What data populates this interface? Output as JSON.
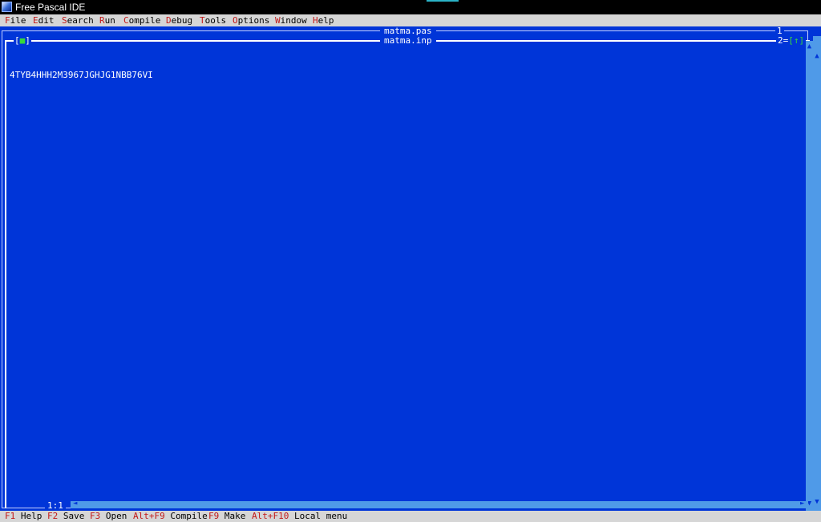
{
  "window": {
    "title": "Free Pascal IDE"
  },
  "menu": [
    {
      "hot": "F",
      "rest": "ile"
    },
    {
      "hot": "E",
      "rest": "dit"
    },
    {
      "hot": "S",
      "rest": "earch"
    },
    {
      "hot": "R",
      "rest": "un"
    },
    {
      "hot": "C",
      "rest": "ompile"
    },
    {
      "hot": "D",
      "rest": "ebug"
    },
    {
      "hot": "T",
      "rest": "ools"
    },
    {
      "hot": "O",
      "rest": "ptions"
    },
    {
      "hot": "W",
      "rest": "indow"
    },
    {
      "hot": "H",
      "rest": "elp"
    }
  ],
  "editor_back": {
    "title": "matma.pas",
    "number": "1"
  },
  "editor_front": {
    "title": "matma.inp",
    "number": "2",
    "close_box": "[■]",
    "zoom_box": "[↑]",
    "lines": [
      "4TYB4HHH2M3967JGHJG1NBB76VI"
    ],
    "cursor": "1:1"
  },
  "status": [
    {
      "key": "F1",
      "label": "Help"
    },
    {
      "key": "F2",
      "label": "Save"
    },
    {
      "key": "F3",
      "label": "Open"
    },
    {
      "key": "Alt+F9",
      "label": "Compile"
    },
    {
      "key": "F9",
      "label": "Make"
    },
    {
      "key": "Alt+F10",
      "label": "Local menu"
    }
  ],
  "colors": {
    "desktop": "#0035d8",
    "menubar": "#d6d6d6",
    "hotkey": "#c21818",
    "scrollbar": "#4f9ae8",
    "accent_green": "#37d83b"
  }
}
